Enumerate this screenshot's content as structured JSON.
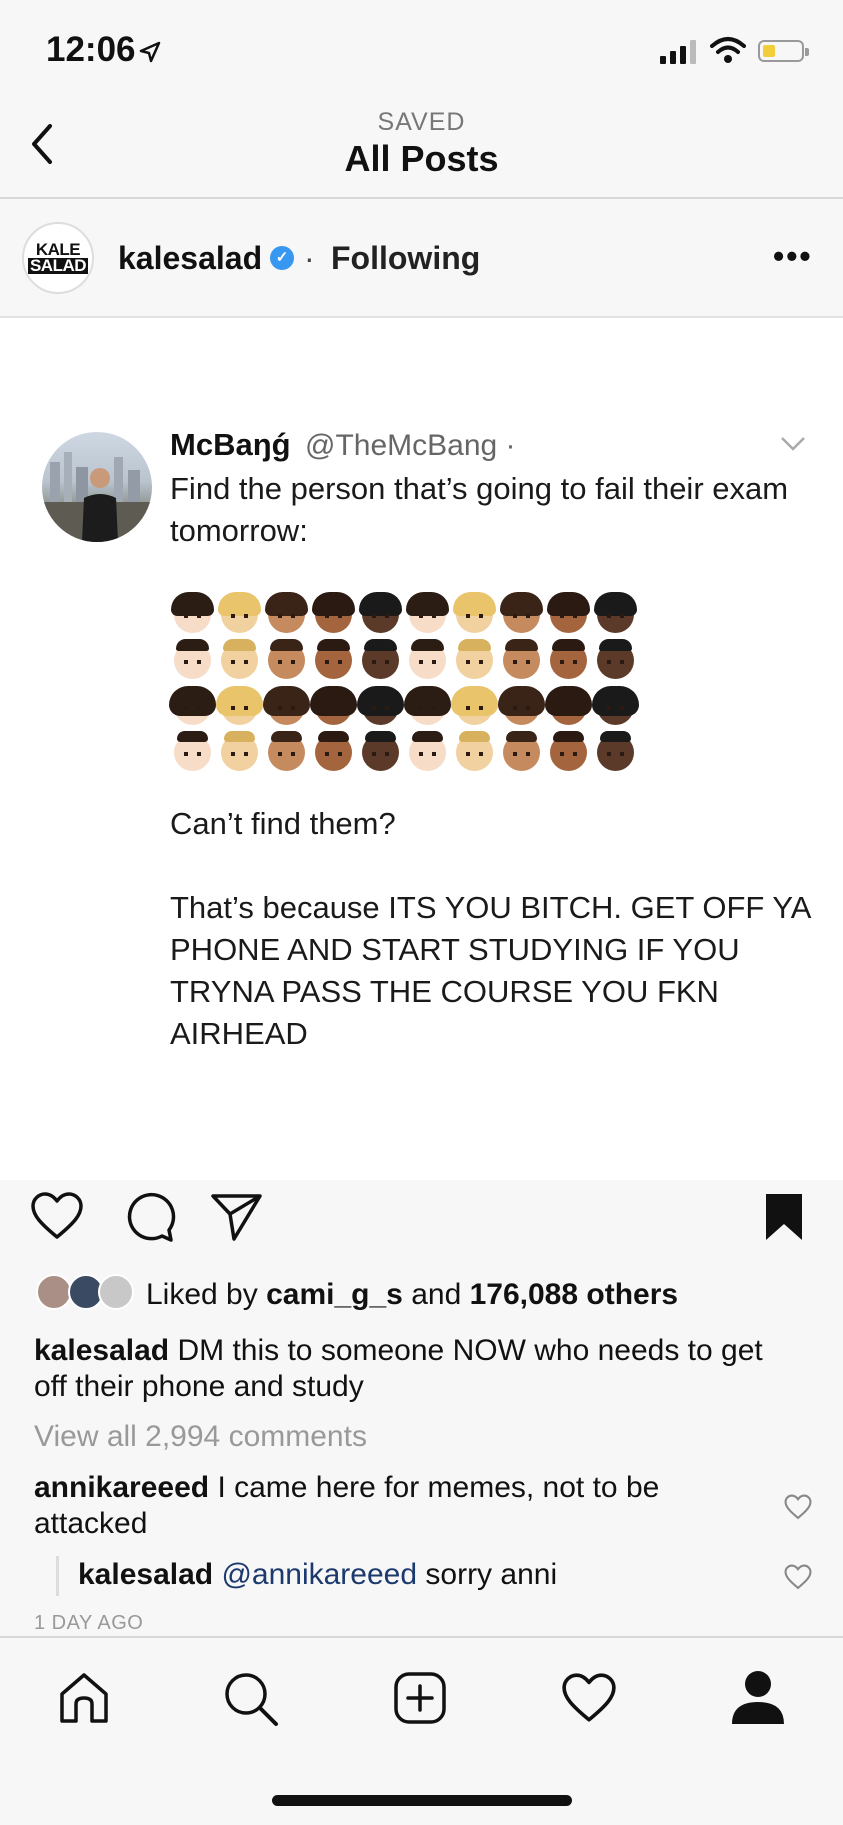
{
  "status": {
    "time": "12:06"
  },
  "nav": {
    "subtitle": "SAVED",
    "title": "All Posts"
  },
  "post_header": {
    "logo_line1": "KALE",
    "logo_line2": "SALAD",
    "account": "kalesalad",
    "separator": "·",
    "following": "Following",
    "more": "•••"
  },
  "tweet": {
    "name": "McBaŋǵ",
    "handle": "@TheMcBang ·",
    "text1": "Find the person that’s going to fail their exam tomorrow:",
    "text2": "Can’t find them?",
    "text3": "That’s because ITS YOU BITCH. GET OFF YA PHONE AND START STUDYING IF YOU TRYNA PASS THE COURSE YOU FKN AIRHEAD"
  },
  "likes": {
    "prefix": "Liked by",
    "user": "cami_g_s",
    "mid": "and",
    "count": "176,088 others"
  },
  "caption": {
    "user": "kalesalad",
    "text": "DM this to someone NOW who needs to get off their phone and study"
  },
  "view_all": "View all 2,994 comments",
  "comments": [
    {
      "user": "annikareeed",
      "text": "I came here for memes, not to be attacked"
    },
    {
      "user": "kalesalad",
      "mention": "@annikareeed",
      "text": "sorry anni"
    }
  ],
  "timestamp": "1 DAY AGO",
  "colors": {
    "verified": "#3897f0",
    "mention": "#1c3a6e",
    "battery": "#f2cf3a"
  },
  "icons": [
    "location-arrow-icon",
    "signal-icon",
    "wifi-icon",
    "battery-icon",
    "back-chevron-icon",
    "verified-badge-icon",
    "more-icon",
    "chevron-down-icon",
    "heart-icon",
    "comment-icon",
    "share-icon",
    "bookmark-icon",
    "home-icon",
    "search-icon",
    "add-post-icon",
    "activity-heart-icon",
    "profile-icon"
  ]
}
